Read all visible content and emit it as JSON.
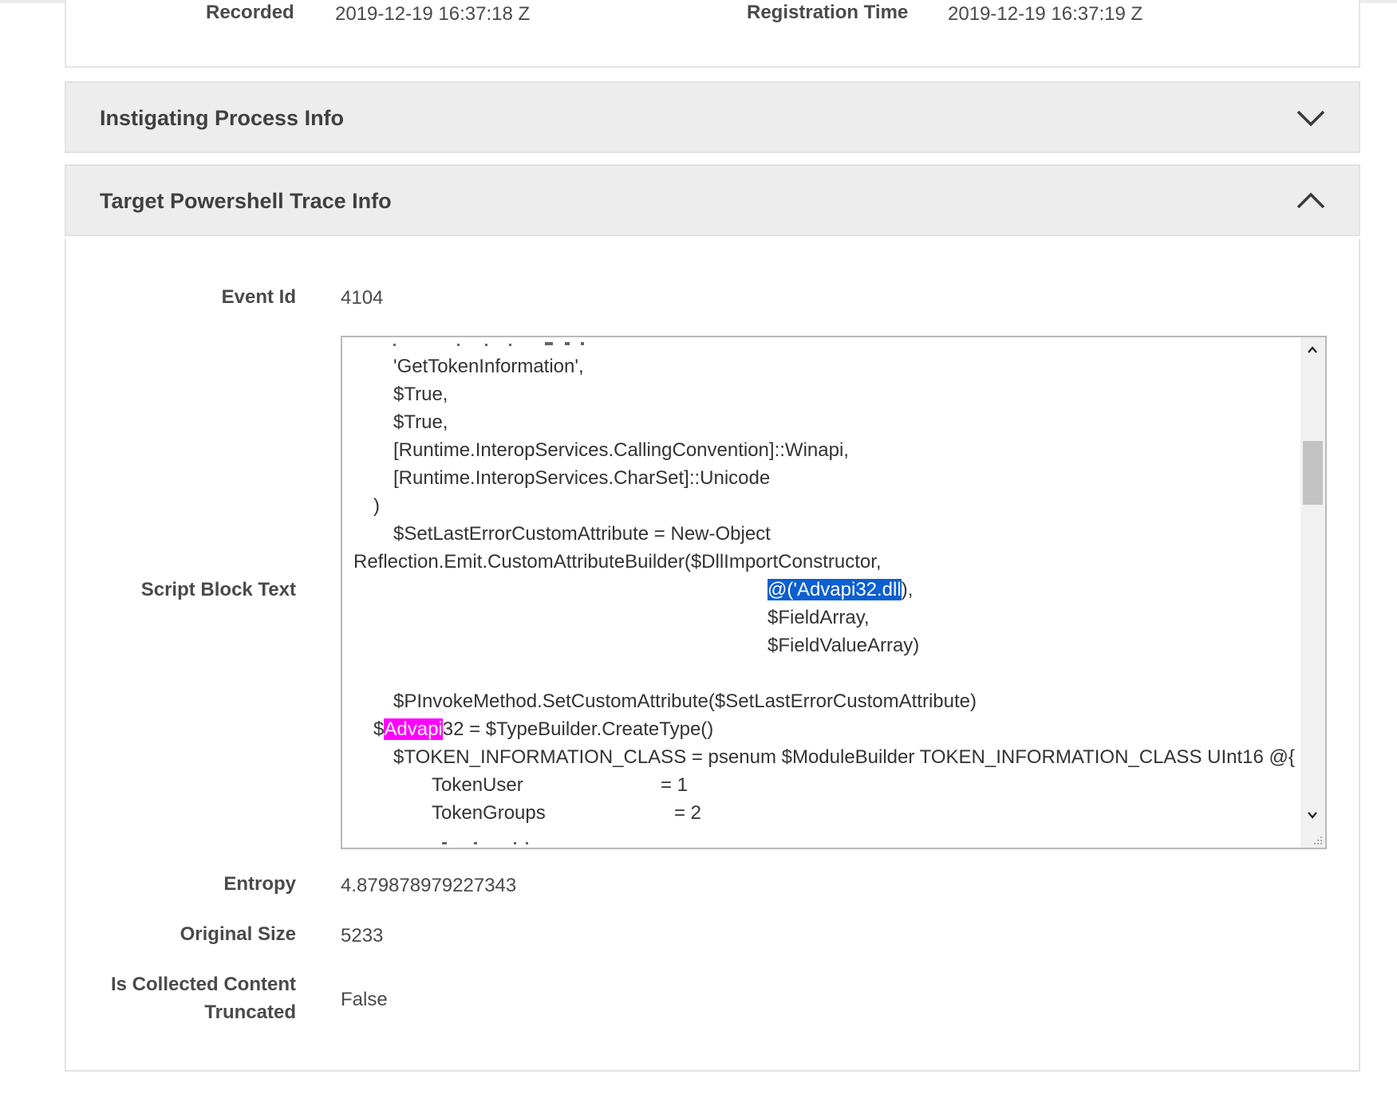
{
  "top_details": {
    "recorded_label": "Recorded",
    "recorded_value": "2019-12-19 16:37:18 Z",
    "registration_label": "Registration Time",
    "registration_value": "2019-12-19 16:37:19 Z"
  },
  "sections": {
    "instigating": {
      "title": "Instigating Process Info",
      "expanded": false,
      "icon": "chevron-down-icon"
    },
    "target": {
      "title": "Target Powershell Trace Info",
      "expanded": true,
      "icon": "chevron-up-icon"
    }
  },
  "fields": {
    "event_id_label": "Event Id",
    "event_id_value": "4104",
    "script_label": "Script Block Text",
    "entropy_label": "Entropy",
    "entropy_value": "4.879878979227343",
    "original_size_label": "Original Size",
    "original_size_value": "5233",
    "truncated_label_line1": "Is Collected Content",
    "truncated_label_line2": "Truncated",
    "truncated_value": "False"
  },
  "script": {
    "lines": [
      "'GetTokenInformation',",
      "$True,",
      "$True,",
      "[Runtime.InteropServices.CallingConvention]::Winapi,",
      "[Runtime.InteropServices.CharSet]::Unicode",
      ")",
      "$SetLastErrorCustomAttribute = New-Object",
      "Reflection.Emit.CustomAttributeBuilder($DllImportConstructor,",
      "),",
      "$FieldArray,",
      "$FieldValueArray)",
      "$PInvokeMethod.SetCustomAttribute($SetLastErrorCustomAttribute)",
      "$",
      "32 = $TypeBuilder.CreateType()",
      "$TOKEN_INFORMATION_CLASS = psenum $ModuleBuilder TOKEN_INFORMATION_CLASS UInt16 @{",
      "TokenUser",
      "= 1",
      "TokenGroups",
      "= 2"
    ],
    "selected_text": "@('Advapi32.dll",
    "search_highlight": "Advapi"
  },
  "colors": {
    "selection": "#0b5fd1",
    "search_highlight": "#ff00ff",
    "header_bg": "#ededed"
  }
}
